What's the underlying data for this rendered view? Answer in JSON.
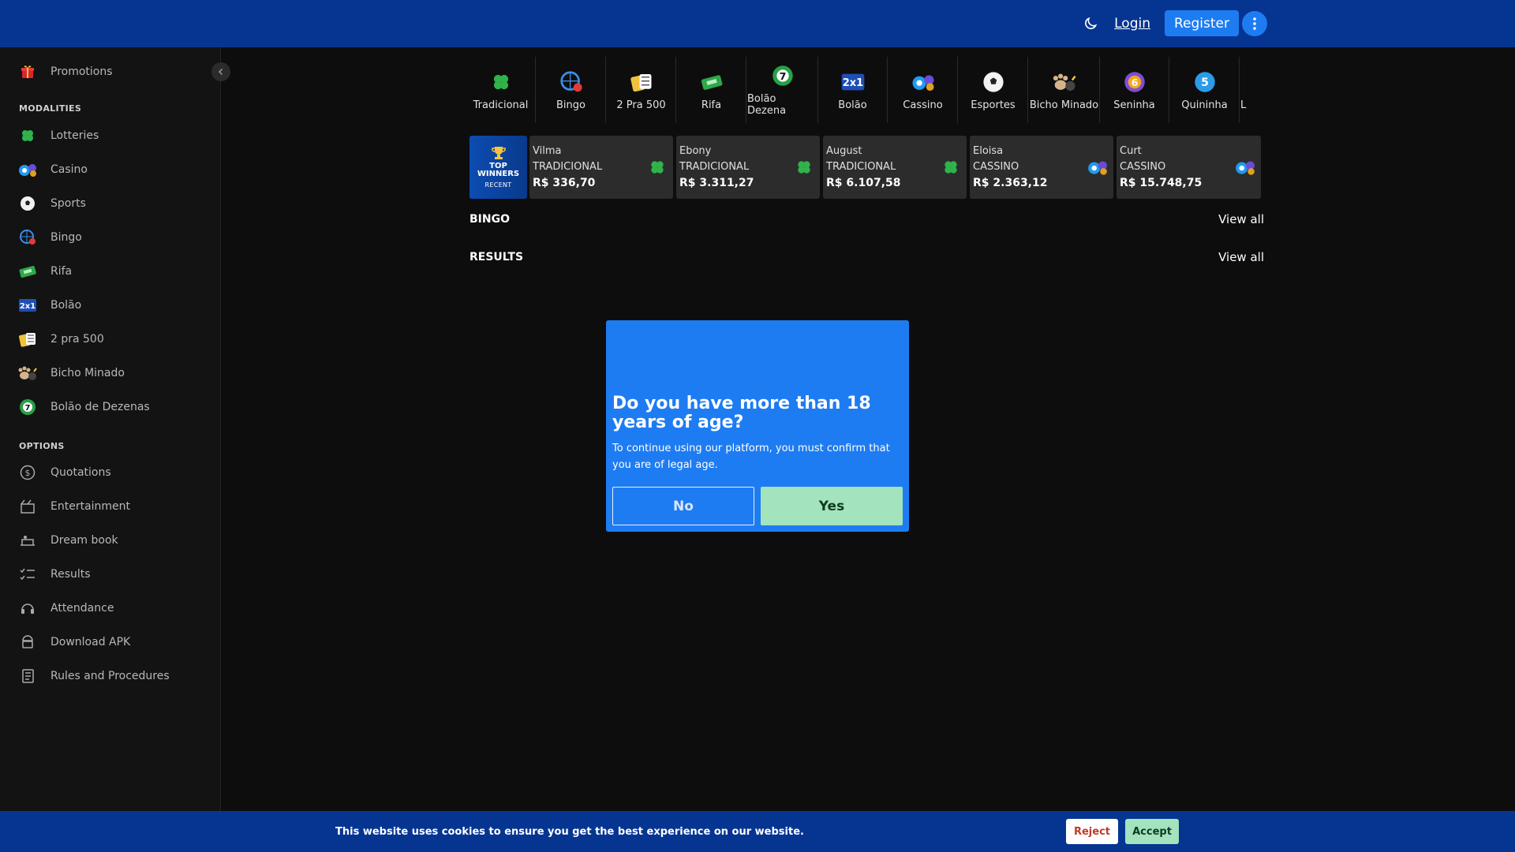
{
  "header": {
    "login": "Login",
    "register": "Register"
  },
  "sidebar": {
    "promotions": "Promotions",
    "modalities_title": "MODALITIES",
    "modalities": [
      "Lotteries",
      "Casino",
      "Sports",
      "Bingo",
      "Rifa",
      "Bolão",
      "2 pra 500",
      "Bicho Minado",
      "Bolão de Dezenas"
    ],
    "options_title": "OPTIONS",
    "options": [
      "Quotations",
      "Entertainment",
      "Dream book",
      "Results",
      "Attendance",
      "Download APK",
      "Rules and Procedures"
    ]
  },
  "categories": [
    "Tradicional",
    "Bingo",
    "2 Pra 500",
    "Rifa",
    "Bolão Dezena",
    "Bolão",
    "Cassino",
    "Esportes",
    "Bicho Minado",
    "Seninha",
    "Quininha",
    "L"
  ],
  "winners": {
    "badge_top": "TOP",
    "badge_winners": "WINNERS",
    "badge_recent": "RECENT",
    "items": [
      {
        "name": "Vilma",
        "game": "TRADICIONAL",
        "amount": "R$ 336,70"
      },
      {
        "name": "Ebony",
        "game": "TRADICIONAL",
        "amount": "R$ 3.311,27"
      },
      {
        "name": "August",
        "game": "TRADICIONAL",
        "amount": "R$ 6.107,58"
      },
      {
        "name": "Eloisa",
        "game": "CASSINO",
        "amount": "R$ 2.363,12"
      },
      {
        "name": "Curt",
        "game": "CASSINO",
        "amount": "R$ 15.748,75"
      }
    ]
  },
  "sections": {
    "bingo": "BINGO",
    "results": "RESULTS",
    "view_all": "View all"
  },
  "modal": {
    "title": "Do you have more than 18 years of age?",
    "text": "To continue using our platform, you must confirm that you are of legal age.",
    "no": "No",
    "yes": "Yes"
  },
  "cookie": {
    "text": "This website uses cookies to ensure you get the best experience on our website.",
    "reject": "Reject",
    "accept": "Accept"
  },
  "colors": {
    "header": "#063591",
    "accent": "#1e7cf2",
    "yes_button": "#a3e3bd",
    "background": "#0d0d0d"
  }
}
